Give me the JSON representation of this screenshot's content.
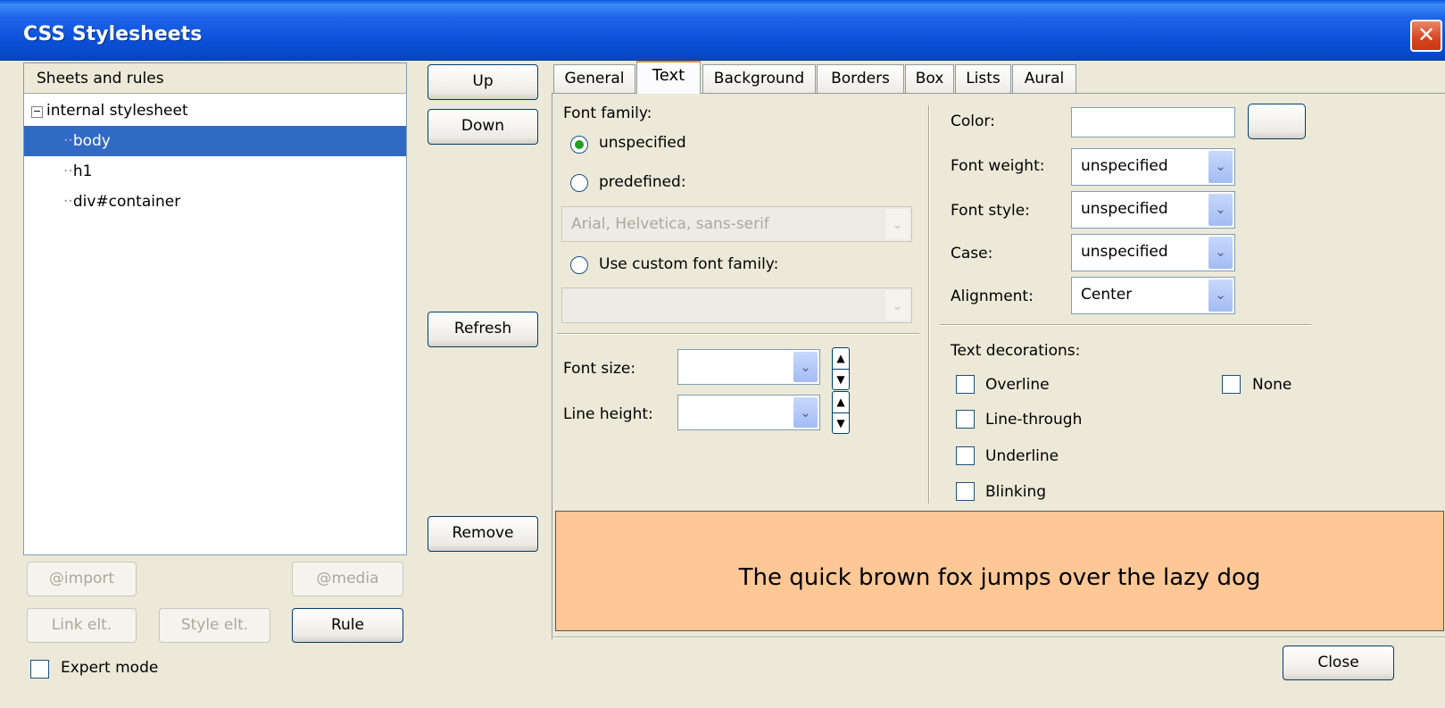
{
  "window": {
    "title": "CSS Stylesheets",
    "close_glyph": "✕"
  },
  "sheets": {
    "header": "Sheets and rules",
    "tree": [
      {
        "label": "internal stylesheet",
        "expander": "−"
      },
      {
        "label": "body",
        "selected": true
      },
      {
        "label": "h1"
      },
      {
        "label": "div#container"
      }
    ],
    "buttons": {
      "import": "@import",
      "media": "@media",
      "link": "Link elt.",
      "style": "Style elt.",
      "rule": "Rule"
    },
    "expert_mode": "Expert mode"
  },
  "actions": {
    "up": "Up",
    "down": "Down",
    "refresh": "Refresh",
    "remove": "Remove"
  },
  "tabs": [
    "General",
    "Text",
    "Background",
    "Borders",
    "Box",
    "Lists",
    "Aural"
  ],
  "active_tab": "Text",
  "font": {
    "family_label": "Font family:",
    "unspecified": "unspecified",
    "predefined": "predefined:",
    "predefined_value": "Arial, Helvetica, sans-serif",
    "custom": "Use custom font family:",
    "custom_value": "",
    "size_label": "Font size:",
    "size_value": "",
    "line_height_label": "Line height:",
    "line_height_value": ""
  },
  "props": {
    "color_label": "Color:",
    "color_value": "",
    "weight_label": "Font weight:",
    "weight_value": "unspecified",
    "style_label": "Font style:",
    "style_value": "unspecified",
    "case_label": "Case:",
    "case_value": "unspecified",
    "align_label": "Alignment:",
    "align_value": "Center"
  },
  "decorations": {
    "label": "Text decorations:",
    "overline": "Overline",
    "line_through": "Line-through",
    "underline": "Underline",
    "blinking": "Blinking",
    "none": "None"
  },
  "preview": {
    "text": "The quick brown fox jumps over the lazy dog",
    "background": "#fdc896"
  },
  "footer": {
    "close": "Close"
  },
  "icons": {
    "dropdown": "chevron-down-icon",
    "spin_up": "▲",
    "spin_down": "▼"
  }
}
